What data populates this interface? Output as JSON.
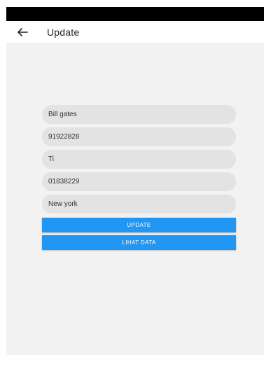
{
  "app_bar": {
    "back_icon": "arrow-left-icon",
    "title": "Update"
  },
  "form": {
    "fields": [
      {
        "name": "name-field",
        "value": "Bill gates"
      },
      {
        "name": "id-field",
        "value": "91922828"
      },
      {
        "name": "class-field",
        "value": "Ti"
      },
      {
        "name": "phone-field",
        "value": "01838229"
      },
      {
        "name": "address-field",
        "value": "New york"
      }
    ],
    "update_label": "UPDATE",
    "view_data_label": "LIHAT DATA"
  },
  "colors": {
    "button": "#2196f3",
    "field_background": "#e3e3e3",
    "page_background": "#f2f2f2",
    "status_bar": "#000000"
  }
}
